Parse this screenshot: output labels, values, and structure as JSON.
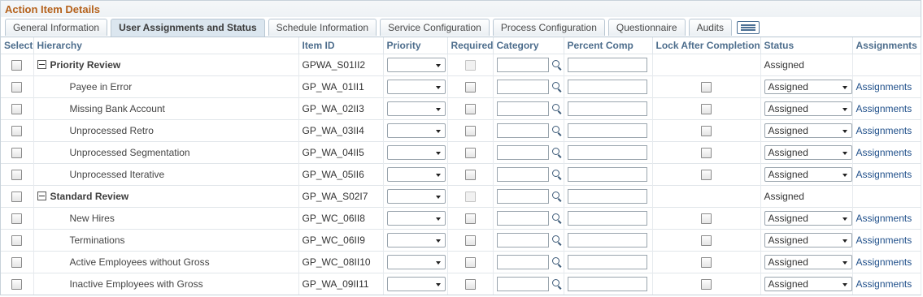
{
  "page": {
    "title": "Action Item Details"
  },
  "tabs": [
    {
      "label": "General Information",
      "active": false
    },
    {
      "label": "User Assignments and Status",
      "active": true
    },
    {
      "label": "Schedule Information",
      "active": false
    },
    {
      "label": "Service Configuration",
      "active": false
    },
    {
      "label": "Process Configuration",
      "active": false
    },
    {
      "label": "Questionnaire",
      "active": false
    },
    {
      "label": "Audits",
      "active": false
    }
  ],
  "columns": [
    "Select",
    "Hierarchy",
    "Item ID",
    "Priority",
    "Required",
    "Category",
    "Percent Comp",
    "Lock After Completion",
    "Status",
    "Assignments"
  ],
  "rows": [
    {
      "type": "parent",
      "label": "Priority Review",
      "item_id": "GPWA_S01II2",
      "status": "Assigned",
      "assignments": ""
    },
    {
      "type": "child",
      "label": "Payee in Error",
      "item_id": "GP_WA_01II1",
      "status": "Assigned",
      "assignments": "Assignments"
    },
    {
      "type": "child",
      "label": "Missing Bank Account",
      "item_id": "GP_WA_02II3",
      "status": "Assigned",
      "assignments": "Assignments"
    },
    {
      "type": "child",
      "label": "Unprocessed Retro",
      "item_id": "GP_WA_03II4",
      "status": "Assigned",
      "assignments": "Assignments"
    },
    {
      "type": "child",
      "label": "Unprocessed Segmentation",
      "item_id": "GP_WA_04II5",
      "status": "Assigned",
      "assignments": "Assignments"
    },
    {
      "type": "child",
      "label": "Unprocessed Iterative",
      "item_id": "GP_WA_05II6",
      "status": "Assigned",
      "assignments": "Assignments"
    },
    {
      "type": "parent",
      "label": "Standard Review",
      "item_id": "GP_WA_S02I7",
      "status": "Assigned",
      "assignments": ""
    },
    {
      "type": "child",
      "label": "New Hires",
      "item_id": "GP_WC_06II8",
      "status": "Assigned",
      "assignments": "Assignments"
    },
    {
      "type": "child",
      "label": "Terminations",
      "item_id": "GP_WC_06II9",
      "status": "Assigned",
      "assignments": "Assignments"
    },
    {
      "type": "child",
      "label": "Active Employees without Gross",
      "item_id": "GP_WC_08II10",
      "status": "Assigned",
      "assignments": "Assignments"
    },
    {
      "type": "child",
      "label": "Inactive Employees with Gross",
      "item_id": "GP_WA_09II11",
      "status": "Assigned",
      "assignments": "Assignments"
    }
  ],
  "icons": {
    "collapse": "collapse-minus-icon",
    "lookup": "lookup-magnifier-icon",
    "tab_overflow": "tab-list-icon"
  }
}
